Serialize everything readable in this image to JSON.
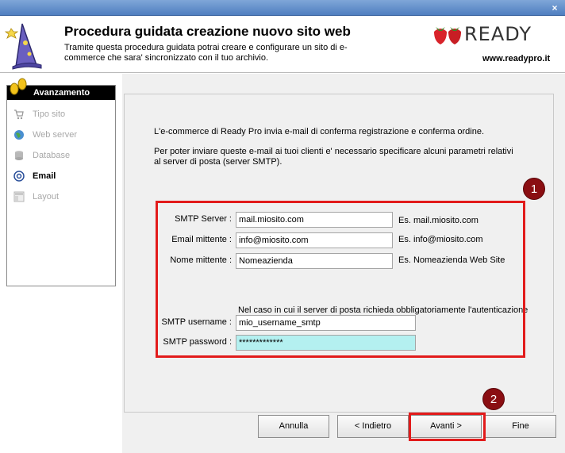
{
  "window": {
    "close_glyph": "×"
  },
  "header": {
    "title": "Procedura guidata creazione nuovo sito web",
    "description": "Tramite questa procedura guidata potrai creare e configurare un sito di e-commerce che sara' sincronizzato con il tuo archivio.",
    "logo_text": "READY",
    "site_url": "www.readypro.it"
  },
  "nav": {
    "heading": "Avanzamento",
    "items": [
      {
        "label": "Tipo sito",
        "icon": "cart-icon",
        "state": "done"
      },
      {
        "label": "Web server",
        "icon": "globe-icon",
        "state": "done"
      },
      {
        "label": "Database",
        "icon": "database-icon",
        "state": "done"
      },
      {
        "label": "Email",
        "icon": "at-icon",
        "state": "active"
      },
      {
        "label": "Layout",
        "icon": "layout-icon",
        "state": "pending"
      }
    ]
  },
  "main": {
    "intro_line1": "L'e-commerce di Ready Pro invia e-mail di conferma registrazione e conferma ordine.",
    "intro_line2": "Per poter inviare queste e-mail ai tuoi clienti e' necessario specificare alcuni parametri relativi al server di posta (server SMTP).",
    "fields": {
      "smtp_server": {
        "label": "SMTP Server :",
        "value": "mail.miosito.com",
        "hint": "Es. mail.miosito.com"
      },
      "email_mittente": {
        "label": "Email mittente :",
        "value": "info@miosito.com",
        "hint": "Es. info@miosito.com"
      },
      "nome_mittente": {
        "label": "Nome mittente :",
        "value": "Nomeazienda",
        "hint": "Es. Nomeazienda Web Site"
      },
      "auth_note": "Nel caso in cui il server di posta richieda obbligatoriamente l'autenticazione specificare username e password SMTP",
      "smtp_username": {
        "label": "SMTP username :",
        "value": "mio_username_smtp"
      },
      "smtp_password": {
        "label": "SMTP password :",
        "value": "*************"
      }
    },
    "annotations": {
      "badge1": "1",
      "badge2": "2"
    }
  },
  "buttons": {
    "cancel": "Annulla",
    "back": "< Indietro",
    "next": "Avanti >",
    "finish": "Fine"
  },
  "colors": {
    "highlight_red": "#e21b1b",
    "badge_bg": "#8a0e12",
    "password_bg": "#b4f0f0",
    "nav_head_bg": "#000000"
  }
}
